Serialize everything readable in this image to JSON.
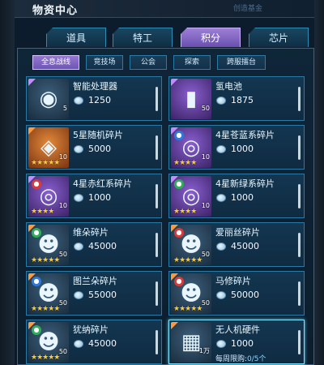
{
  "window": {
    "title": "物资中心",
    "bg_text": "创造基金"
  },
  "tabs": [
    {
      "label": "道具",
      "active": false
    },
    {
      "label": "特工",
      "active": false
    },
    {
      "label": "积分",
      "active": true
    },
    {
      "label": "芯片",
      "active": false
    }
  ],
  "subtabs": [
    {
      "label": "全息战线",
      "active": true
    },
    {
      "label": "竞技场",
      "active": false
    },
    {
      "label": "公会",
      "active": false
    },
    {
      "label": "探索",
      "active": false
    },
    {
      "label": "跨服擂台",
      "active": false
    }
  ],
  "items": [
    {
      "name": "智能处理器",
      "price": "1250",
      "count": "5",
      "stars": "",
      "icon": "robot-device-icon",
      "element": "",
      "theme": "gray",
      "quality": "p"
    },
    {
      "name": "氢电池",
      "price": "1875",
      "count": "50",
      "stars": "",
      "icon": "battery-icon",
      "element": "",
      "theme": "purple",
      "quality": "p"
    },
    {
      "name": "5星随机碎片",
      "price": "5000",
      "count": "10",
      "stars": "★★★★★",
      "icon": "random-fragment-icon",
      "element": "",
      "theme": "orange",
      "quality": "o"
    },
    {
      "name": "4星苍蓝系碎片",
      "price": "1000",
      "count": "10",
      "stars": "★★★★",
      "icon": "blue-fragment-icon",
      "element": "水",
      "elementColor": "blue",
      "theme": "purple",
      "quality": "p"
    },
    {
      "name": "4星赤红系碎片",
      "price": "1000",
      "count": "10",
      "stars": "★★★★",
      "icon": "red-fragment-icon",
      "element": "火",
      "elementColor": "red",
      "theme": "purple",
      "quality": "p"
    },
    {
      "name": "4星新绿系碎片",
      "price": "1000",
      "count": "10",
      "stars": "★★★★",
      "icon": "green-fragment-icon",
      "element": "木",
      "elementColor": "green",
      "theme": "purple",
      "quality": "p"
    },
    {
      "name": "维朵碎片",
      "price": "45000",
      "count": "50",
      "stars": "★★★★★",
      "icon": "agent-portrait-icon",
      "element": "木",
      "elementColor": "green",
      "theme": "gray",
      "quality": "o"
    },
    {
      "name": "爱丽丝碎片",
      "price": "45000",
      "count": "50",
      "stars": "★★★★★",
      "icon": "agent-portrait-icon",
      "element": "火",
      "elementColor": "red",
      "theme": "gray",
      "quality": "o"
    },
    {
      "name": "图兰朵碎片",
      "price": "55000",
      "count": "50",
      "stars": "★★★★★",
      "icon": "agent-portrait-icon",
      "element": "光",
      "elementColor": "blue",
      "theme": "gray",
      "quality": "o"
    },
    {
      "name": "马修碎片",
      "price": "50000",
      "count": "50",
      "stars": "★★★★★",
      "icon": "agent-portrait-icon",
      "element": "火",
      "elementColor": "red",
      "theme": "gray",
      "quality": "o"
    },
    {
      "name": "犹纳碎片",
      "price": "45000",
      "count": "50",
      "stars": "★★★★★",
      "icon": "agent-portrait-icon",
      "element": "木",
      "elementColor": "green",
      "theme": "gray",
      "quality": "o"
    },
    {
      "name": "无人机硬件",
      "price": "1000",
      "count": "1万",
      "stars": "",
      "icon": "drone-hardware-icon",
      "element": "",
      "theme": "gray",
      "quality": "o",
      "limit_label": "每周限购:",
      "limit_value": "0/5个"
    }
  ]
}
